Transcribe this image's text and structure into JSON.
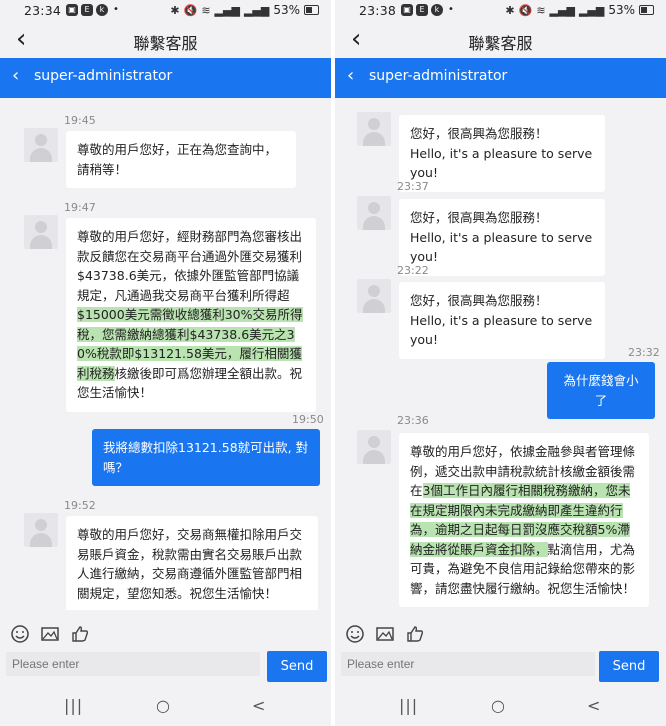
{
  "left": {
    "status": {
      "time": "23:34",
      "apps": [
        "▣",
        "E",
        "k"
      ],
      "dot": "•",
      "icons": [
        "✱",
        "🔇",
        "≋",
        "▂▄▆",
        "▂▄▆"
      ],
      "battery": "53%"
    },
    "nav_title": "聯繫客服",
    "contact_name": "super-administrator",
    "messages": [
      {
        "time": "19:45",
        "dir": "in",
        "text": "尊敬的用戶您好，正在為您查詢中，請稍等！"
      },
      {
        "time": "19:47",
        "dir": "in",
        "text_pre": "尊敬的用戶您好，經財務部門為您審核出款反饋您在交易商平台通過外匯交易獲利$43738.6美元，依據外匯監管部門協議規定，凡通過我交易商平台獲利所得超",
        "text_hl": "$15000美元需徵收總獲利30%交易所得稅，您需繳納總獲利$43738.6美元之30%稅款即$13121.58美元，履行相關獲利稅務",
        "text_post": "核繳後即可爲您辦理全額出款。祝您生活愉快！"
      },
      {
        "time": "19:50",
        "dir": "out",
        "text": "我將總數扣除13121.58就可出款, 對嗎？"
      },
      {
        "time": "19:52",
        "dir": "in",
        "text": "尊敬的用戶您好，交易商無權扣除用戶交易賬戶資金，稅款需由實名交易賬戶出款人進行繳納，交易商遵循外匯監管部門相關規定，望您知悉。祝您生活愉快！"
      }
    ],
    "input_placeholder": "Please enter",
    "send_label": "Send"
  },
  "right": {
    "status": {
      "time": "23:38",
      "apps": [
        "▣",
        "E",
        "k"
      ],
      "dot": "•",
      "icons": [
        "✱",
        "🔇",
        "≋",
        "▂▄▆",
        "▂▄▆"
      ],
      "battery": "53%"
    },
    "nav_title": "聯繫客服",
    "contact_name": "super-administrator",
    "messages": [
      {
        "time": "",
        "dir": "in",
        "text": "您好，很高興為您服務！\nHello, it's a pleasure to serve you!"
      },
      {
        "time": "23:37",
        "dir": "in",
        "text": "您好，很高興為您服務！\nHello, it's a pleasure to serve you!"
      },
      {
        "time": "23:22",
        "dir": "in",
        "text": "您好，很高興為您服務！\nHello, it's a pleasure to serve you!"
      },
      {
        "time": "23:32",
        "dir": "out",
        "text": "為什麼錢會小了"
      },
      {
        "time": "23:36",
        "dir": "in",
        "text_pre": "尊敬的用戶您好，依據金融參與者管理條例，遞交出款申請稅款統計核繳金額後需在",
        "text_hl": "3個工作日內履行相關稅務繳納，您未在規定期限內未完成繳納即產生違約行為，逾期之日起每日罰沒應交稅額5%滯納金將從賬戶資金扣除，",
        "text_post": "點滴信用，尤為可貴，為避免不良信用記錄給您帶來的影響，請您盡快履行繳納。祝您生活愉快！"
      }
    ],
    "input_placeholder": "Please enter",
    "send_label": "Send"
  },
  "icons": {
    "back": "chevron-left-icon",
    "header_back": "chevron-left-icon",
    "emoji": "smiley-icon",
    "image": "image-icon",
    "like": "thumbs-up-icon",
    "nav_recents": "recents-icon",
    "nav_home": "home-icon",
    "nav_back": "back-icon"
  },
  "nav_glyphs": {
    "recents": "|||",
    "home": "○",
    "back": "<"
  },
  "colors": {
    "accent": "#1976f0",
    "highlight": "#b9e3b0",
    "background": "#f2f2f4"
  }
}
